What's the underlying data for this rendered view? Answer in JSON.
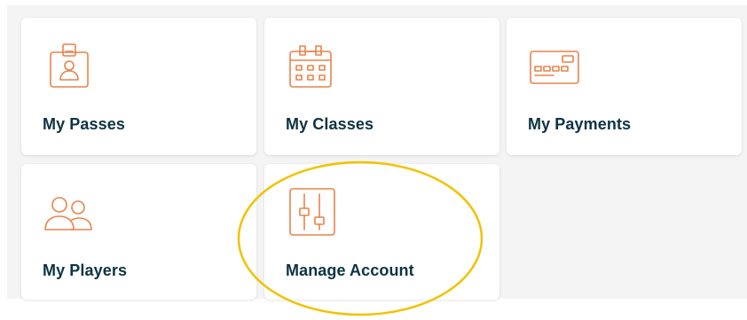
{
  "tiles": {
    "passes": {
      "label": "My Passes",
      "icon": "id-badge-icon"
    },
    "classes": {
      "label": "My Classes",
      "icon": "calendar-icon"
    },
    "payments": {
      "label": "My Payments",
      "icon": "credit-card-icon"
    },
    "players": {
      "label": "My Players",
      "icon": "users-icon"
    },
    "account": {
      "label": "Manage Account",
      "icon": "sliders-icon"
    }
  },
  "colors": {
    "icon_accent": "#e8834a",
    "label_text": "#0d3343",
    "highlight_ring": "#f2c200",
    "panel_background": "#f4f4f4",
    "tile_background": "#ffffff"
  }
}
